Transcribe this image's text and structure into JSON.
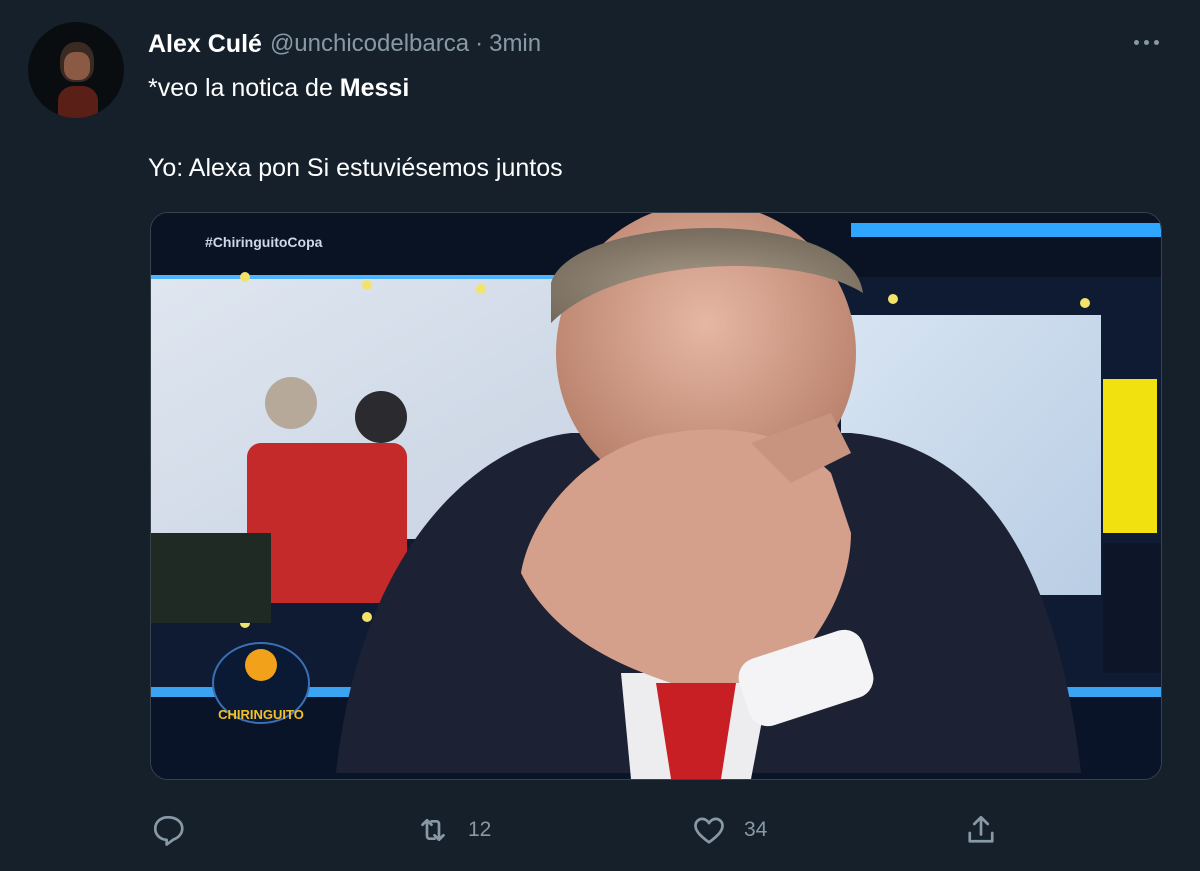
{
  "tweet": {
    "author_name": "Alex Culé",
    "author_handle": "@unchicodelbarca",
    "separator": "·",
    "time": "3min",
    "text_line1_pre": "*veo la notica de ",
    "text_line1_bold": "Messi",
    "text_line2": "Yo: Alexa pon Si estuviésemos juntos",
    "media": {
      "overlay_hashtag": "#ChiringuitoCopa",
      "overlay_logo_text": "CHIRINGUITO"
    },
    "actions": {
      "reply_count": "",
      "retweet_count": "12",
      "like_count": "34"
    }
  },
  "icons": {
    "more": "more-horizontal-icon",
    "reply": "reply-icon",
    "retweet": "retweet-icon",
    "like": "heart-icon",
    "share": "share-icon"
  },
  "colors": {
    "background": "#15202b",
    "secondary_text": "#8899a6",
    "primary_text": "#ffffff"
  }
}
